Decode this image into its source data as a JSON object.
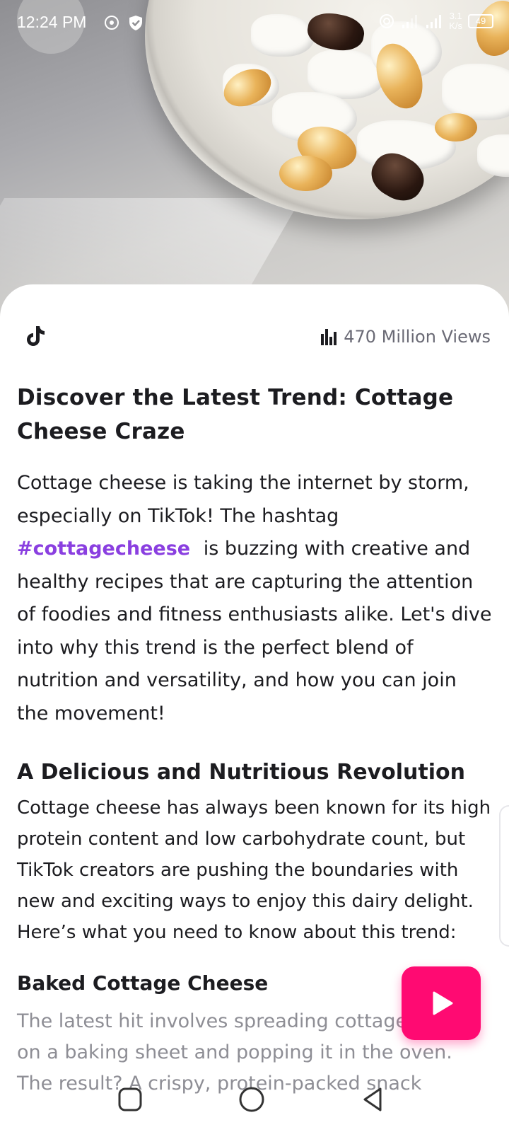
{
  "status_bar": {
    "time": "12:24 PM",
    "network_speed_value": "3.1",
    "network_speed_unit": "K/s",
    "battery_level": "49",
    "icons": [
      "hotspot-icon",
      "shield-check-icon",
      "wifi-calling-icon",
      "signal-icon",
      "signal-icon"
    ]
  },
  "hero": {
    "image_description_icon": "cottage-cheese-bowl-image"
  },
  "card": {
    "source_icon": "tiktok-icon",
    "views_icon": "bar-chart-icon",
    "views_text": "470 Million Views"
  },
  "article": {
    "title": "Discover the Latest Trend: Cottage Cheese Craze",
    "intro_before": "Cottage cheese is taking the internet by storm, especially on TikTok! The hashtag",
    "hashtag": "#cottagecheese",
    "intro_after": "is buzzing with creative and healthy recipes that are capturing the attention of foodies and fitness enthusiasts alike. Let's dive into why this trend is the perfect blend of nutrition and versatility, and how you can join the movement!",
    "section1_heading": "A Delicious and Nutritious Revolution",
    "section1_text": "Cottage cheese has always been known for its high protein content and low carbohydrate count, but TikTok creators are pushing the boundaries with new and exciting ways to enjoy this dairy delight. Here’s what you need to know about this trend:",
    "section2_heading": "Baked Cottage Cheese",
    "section2_text": "The latest hit involves spreading cottage cheese on a baking sheet and popping it in the oven. The result? A crispy, protein-packed snack"
  },
  "colors": {
    "accent": "#ff0a72",
    "hashtag": "#8a3fe0",
    "muted_text": "#6a6a75"
  },
  "fab": {
    "icon": "play-icon"
  },
  "nav_bar": {
    "icons": [
      "recents-square-icon",
      "home-circle-icon",
      "back-triangle-icon"
    ]
  }
}
